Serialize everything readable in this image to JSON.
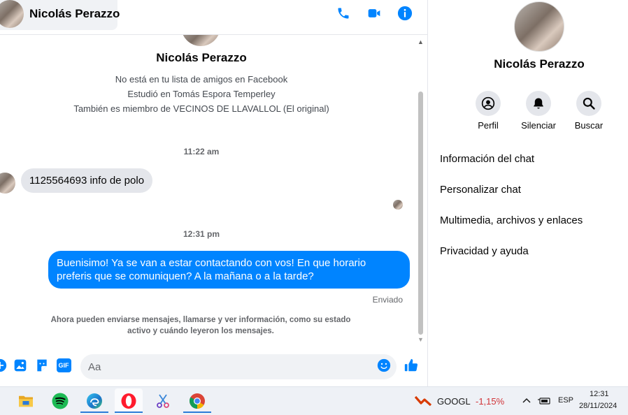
{
  "header": {
    "contact_name": "Nicolás Perazzo",
    "icons": [
      "phone-icon",
      "video-icon",
      "info-icon"
    ]
  },
  "profile": {
    "name": "Nicolás Perazzo",
    "lines": [
      "No está en tu lista de amigos en Facebook",
      "Estudió en Tomás Espora Temperley",
      "También es miembro de VECINOS DE LLAVALLOL (El original)"
    ]
  },
  "messages": {
    "time_1": "11:22 am",
    "incoming_1": "1125564693 info de polo",
    "time_2": "12:31 pm",
    "outgoing_1": "Buenisimo! Ya se van a estar contactando con vos! En que horario preferis que se comuniquen? A la mañana o a la tarde?",
    "status": "Enviado",
    "info_note": "Ahora pueden enviarse mensajes, llamarse y ver información, como su estado activo y cuándo leyeron los mensajes."
  },
  "composer": {
    "placeholder": "Aa",
    "icons": [
      "plus-icon",
      "image-icon",
      "sticker-icon",
      "gif-icon",
      "emoji-icon",
      "like-icon"
    ],
    "gif_label": "GIF"
  },
  "side_panel": {
    "name": "Nicolás Perazzo",
    "actions": [
      {
        "label": "Perfil",
        "icon": "profile-icon"
      },
      {
        "label": "Silenciar",
        "icon": "bell-icon"
      },
      {
        "label": "Buscar",
        "icon": "search-icon"
      }
    ],
    "menu": [
      "Información del chat",
      "Personalizar chat",
      "Multimedia, archivos y enlaces",
      "Privacidad y ayuda"
    ]
  },
  "taskbar": {
    "apps": [
      "file-explorer",
      "spotify",
      "edge",
      "opera",
      "snipping-tool",
      "chrome"
    ],
    "stock_ticker": "GOOGL",
    "stock_change": "-1,15%",
    "language": "ESP",
    "time": "12:31",
    "date": "28/11/2024"
  },
  "colors": {
    "accent": "#0084ff",
    "bubble_in": "#e4e6eb",
    "stock_negative": "#d13438"
  }
}
